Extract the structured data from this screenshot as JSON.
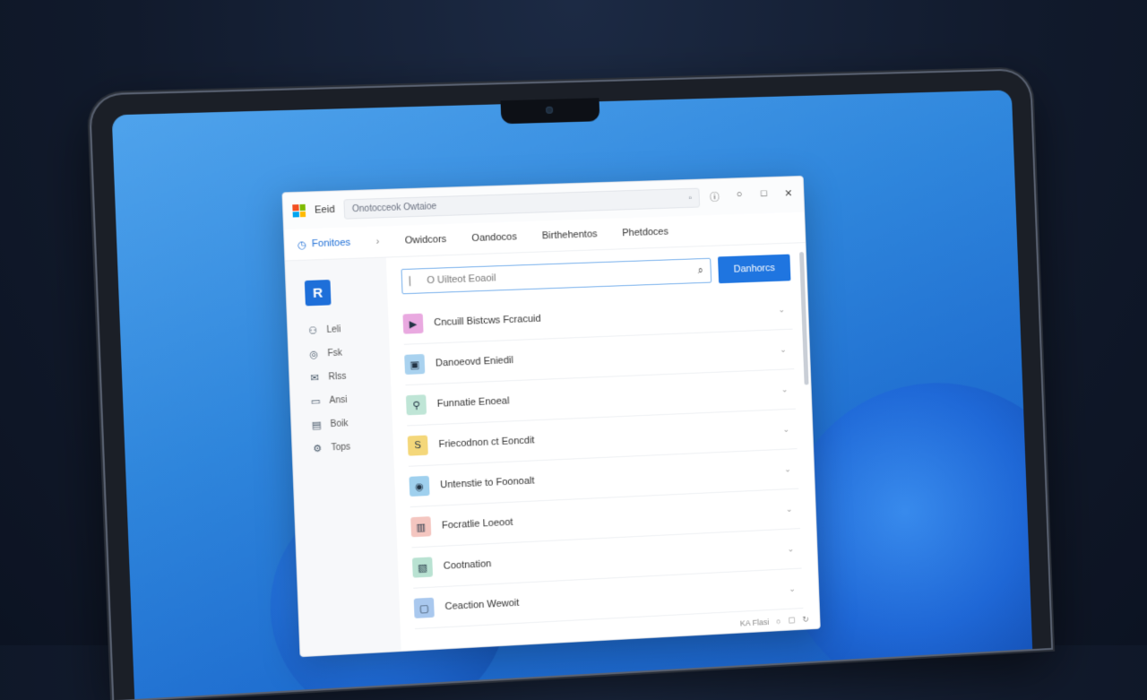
{
  "window": {
    "app_title": "Eeid",
    "address": "Onotocceok Owtaioe",
    "controls": [
      "ⓘ",
      "○",
      "□",
      "✕"
    ]
  },
  "nav": {
    "active": "Fonitoes",
    "tabs": [
      "Owidcors",
      "Oandocos",
      "Birthehentos",
      "Phetdoces"
    ]
  },
  "sidebar": {
    "logo_letter": "R",
    "items": [
      {
        "icon": "people-icon",
        "glyph": "⚇",
        "label": "Leli"
      },
      {
        "icon": "chat-icon",
        "glyph": "◎",
        "label": "Fsk"
      },
      {
        "icon": "mail-icon",
        "glyph": "✉",
        "label": "Rlss"
      },
      {
        "icon": "message-icon",
        "glyph": "▭",
        "label": "Ansi"
      },
      {
        "icon": "document-icon",
        "glyph": "▤",
        "label": "Boik"
      },
      {
        "icon": "settings-icon",
        "glyph": "⚙",
        "label": "Tops"
      }
    ]
  },
  "search": {
    "placeholder": "O Uilteot Eoaoil",
    "button_label": "Danhorcs"
  },
  "list": {
    "items": [
      {
        "label": "Cncuill Bistcws Fcracuid",
        "icon": "play-icon",
        "glyph": "▶",
        "bg": "#e9a9e0"
      },
      {
        "label": "Danoeovd Eniedil",
        "icon": "tablet-icon",
        "glyph": "▣",
        "bg": "#a9d2ef"
      },
      {
        "label": "Funnatie Enoeal",
        "icon": "location-icon",
        "glyph": "⚲",
        "bg": "#bfe5d6"
      },
      {
        "label": "Friecodnon ct Eoncdit",
        "icon": "s-app-icon",
        "glyph": "S",
        "bg": "#f4d77a"
      },
      {
        "label": "Untenstie to Foonoalt",
        "icon": "camera-icon",
        "glyph": "◉",
        "bg": "#9fd0ee"
      },
      {
        "label": "Focratlie Loeoot",
        "icon": "card-icon",
        "glyph": "▥",
        "bg": "#f4c6c0"
      },
      {
        "label": "Cootnation",
        "icon": "box-icon",
        "glyph": "▧",
        "bg": "#b9e2d2"
      },
      {
        "label": "Ceaction Wewoit",
        "icon": "frame-icon",
        "glyph": "▢",
        "bg": "#a9c8ee"
      }
    ]
  },
  "status": {
    "text": "KA Flasi"
  },
  "colors": {
    "accent": "#1f75e0",
    "wallpaper": "#2f86dc"
  }
}
